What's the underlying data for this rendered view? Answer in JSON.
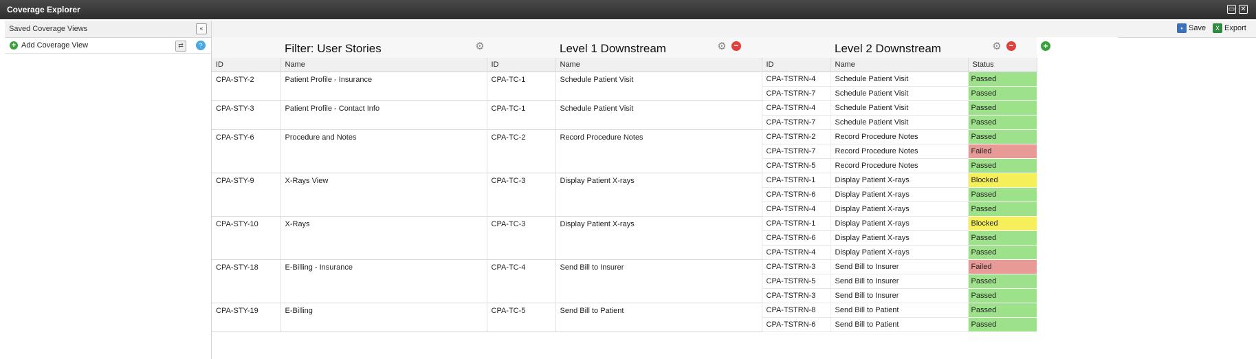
{
  "window": {
    "title": "Coverage Explorer"
  },
  "sidebar": {
    "header": "Saved Coverage Views",
    "collapse_icon": "double-chevron-left-icon",
    "add_label": "Add Coverage View"
  },
  "toolbar": {
    "save_label": "Save",
    "export_label": "Export"
  },
  "sections": {
    "filter_title": "Filter: User Stories",
    "level1_title": "Level 1 Downstream",
    "level2_title": "Level 2 Downstream"
  },
  "columns": {
    "id": "ID",
    "name": "Name",
    "l1_id": "ID",
    "l1_name": "Name",
    "l2_id": "ID",
    "l2_name": "Name",
    "status": "Status"
  },
  "status_colors": {
    "Passed": "#9de28a",
    "Failed": "#e89a96",
    "Blocked": "#f5f05a"
  },
  "groups": [
    {
      "story_id": "CPA-STY-2",
      "story_name": "Patient Profile - Insurance",
      "tc_id": "CPA-TC-1",
      "tc_name": "Schedule Patient Visit",
      "runs": [
        {
          "id": "CPA-TSTRN-4",
          "name": "Schedule Patient Visit",
          "status": "Passed"
        },
        {
          "id": "CPA-TSTRN-7",
          "name": "Schedule Patient Visit",
          "status": "Passed"
        }
      ]
    },
    {
      "story_id": "CPA-STY-3",
      "story_name": "Patient Profile - Contact Info",
      "tc_id": "CPA-TC-1",
      "tc_name": "Schedule Patient Visit",
      "runs": [
        {
          "id": "CPA-TSTRN-4",
          "name": "Schedule Patient Visit",
          "status": "Passed"
        },
        {
          "id": "CPA-TSTRN-7",
          "name": "Schedule Patient Visit",
          "status": "Passed"
        }
      ]
    },
    {
      "story_id": "CPA-STY-6",
      "story_name": "Procedure and Notes",
      "tc_id": "CPA-TC-2",
      "tc_name": "Record Procedure Notes",
      "runs": [
        {
          "id": "CPA-TSTRN-2",
          "name": "Record Procedure Notes",
          "status": "Passed"
        },
        {
          "id": "CPA-TSTRN-7",
          "name": "Record Procedure Notes",
          "status": "Failed"
        },
        {
          "id": "CPA-TSTRN-5",
          "name": "Record Procedure Notes",
          "status": "Passed"
        }
      ]
    },
    {
      "story_id": "CPA-STY-9",
      "story_name": "X-Rays View",
      "tc_id": "CPA-TC-3",
      "tc_name": "Display Patient X-rays",
      "runs": [
        {
          "id": "CPA-TSTRN-1",
          "name": "Display Patient X-rays",
          "status": "Blocked"
        },
        {
          "id": "CPA-TSTRN-6",
          "name": "Display Patient X-rays",
          "status": "Passed"
        },
        {
          "id": "CPA-TSTRN-4",
          "name": "Display Patient X-rays",
          "status": "Passed"
        }
      ]
    },
    {
      "story_id": "CPA-STY-10",
      "story_name": "X-Rays",
      "tc_id": "CPA-TC-3",
      "tc_name": "Display Patient X-rays",
      "runs": [
        {
          "id": "CPA-TSTRN-1",
          "name": "Display Patient X-rays",
          "status": "Blocked"
        },
        {
          "id": "CPA-TSTRN-6",
          "name": "Display Patient X-rays",
          "status": "Passed"
        },
        {
          "id": "CPA-TSTRN-4",
          "name": "Display Patient X-rays",
          "status": "Passed"
        }
      ]
    },
    {
      "story_id": "CPA-STY-18",
      "story_name": "E-Billing - Insurance",
      "tc_id": "CPA-TC-4",
      "tc_name": "Send Bill to Insurer",
      "runs": [
        {
          "id": "CPA-TSTRN-3",
          "name": "Send Bill to Insurer",
          "status": "Failed"
        },
        {
          "id": "CPA-TSTRN-5",
          "name": "Send Bill to Insurer",
          "status": "Passed"
        },
        {
          "id": "CPA-TSTRN-3",
          "name": "Send Bill to Insurer",
          "status": "Passed"
        }
      ]
    },
    {
      "story_id": "CPA-STY-19",
      "story_name": "E-Billing",
      "tc_id": "CPA-TC-5",
      "tc_name": "Send Bill to Patient",
      "runs": [
        {
          "id": "CPA-TSTRN-8",
          "name": "Send Bill to Patient",
          "status": "Passed"
        },
        {
          "id": "CPA-TSTRN-6",
          "name": "Send Bill to Patient",
          "status": "Passed"
        }
      ]
    }
  ]
}
